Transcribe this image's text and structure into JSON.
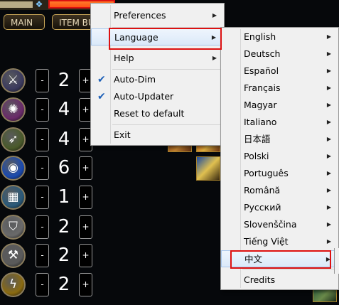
{
  "game": {
    "tabs": {
      "main": "MAIN",
      "item": "ITEM BUILDS"
    },
    "rows": [
      {
        "icon": "crossed-swords-icon",
        "glyph": "⚔",
        "color": "#3b3a5e",
        "count": "2"
      },
      {
        "icon": "gear-orb-icon",
        "glyph": "✺",
        "color": "#6a2a6a",
        "count": "4"
      },
      {
        "icon": "bow-icon",
        "glyph": "➶",
        "color": "#4a5a2a",
        "count": "4"
      },
      {
        "icon": "water-orb-icon",
        "glyph": "◉",
        "color": "#1a4ab0",
        "count": "6"
      },
      {
        "icon": "chainmail-icon",
        "glyph": "▦",
        "color": "#2a5a7a",
        "count": "1"
      },
      {
        "icon": "cloak-icon",
        "glyph": "⛉",
        "color": "#6a6a6a",
        "count": "2"
      },
      {
        "icon": "anvil-icon",
        "glyph": "⚒",
        "color": "#5a5a5a",
        "count": "2"
      },
      {
        "icon": "lightning-icon",
        "glyph": "ϟ",
        "color": "#8a6a10",
        "count": "2"
      }
    ],
    "minus": "-",
    "plus": "+"
  },
  "menu": {
    "items": {
      "preferences": "Preferences",
      "language": "Language",
      "help": "Help",
      "auto_dim": "Auto-Dim",
      "auto_updater": "Auto-Updater",
      "reset": "Reset to default",
      "exit": "Exit"
    },
    "checked": {
      "auto_dim": true,
      "auto_updater": true
    }
  },
  "languages": [
    "English",
    "Deutsch",
    "Español",
    "Français",
    "Magyar",
    "Italiano",
    "日本語",
    "Polski",
    "Português",
    "Română",
    "Русский",
    "Slovenščina",
    "Tiếng Việt",
    "中文",
    "Credits"
  ],
  "icons": {
    "arrow": "▶",
    "check": "✔",
    "gem": "❖"
  },
  "colors": {
    "highlight_red": "#dd1111",
    "accent_orange": "#ff5a18",
    "menu_bg": "#f0f0f0"
  }
}
